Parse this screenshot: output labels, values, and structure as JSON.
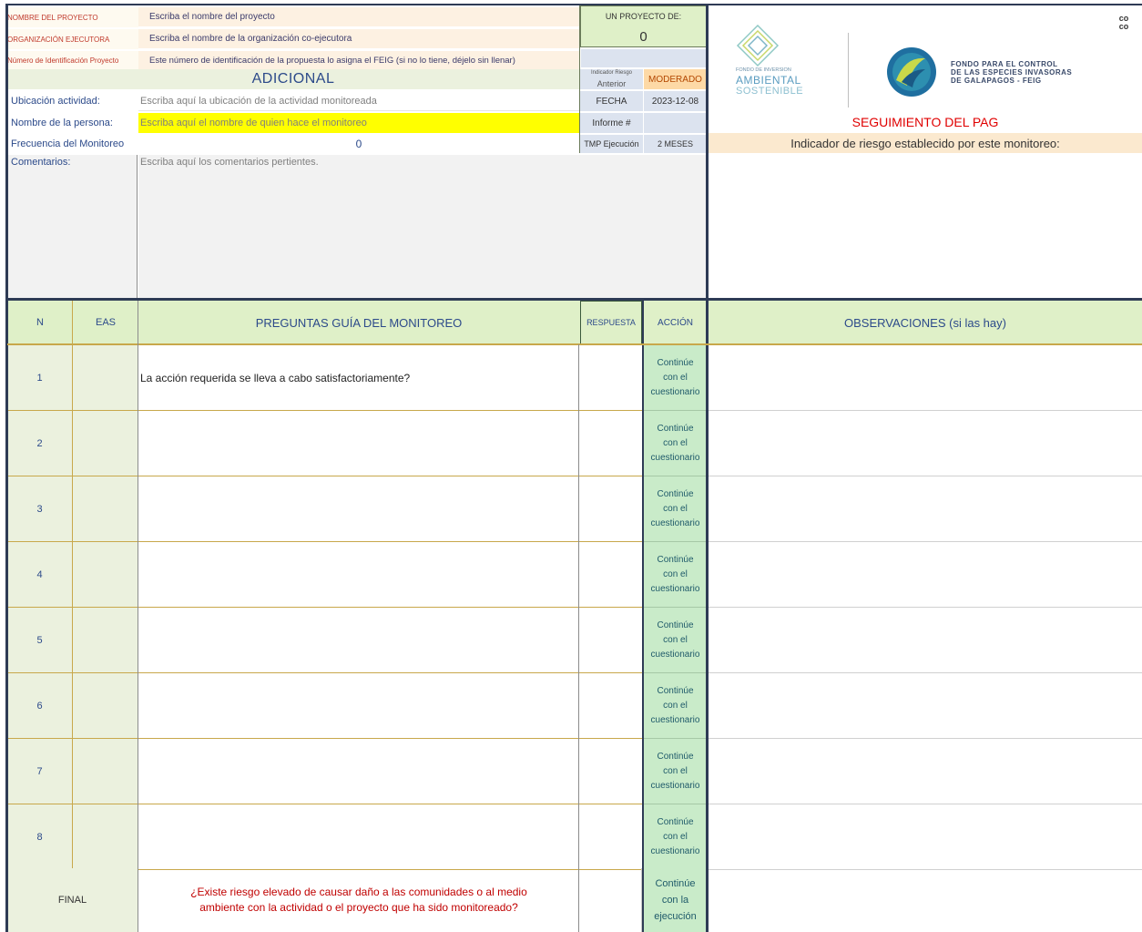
{
  "header": {
    "nombre_label": "NOMBRE DEL PROYECTO",
    "nombre_value": "Escriba el nombre del proyecto",
    "org_label": "ORGANIZACIÓN EJECUTORA",
    "org_value": "Escriba el nombre de la organización co-ejecutora",
    "id_label": "Número de Identificación Proyecto",
    "id_value": "Este número de identificación de la propuesta lo asigna el FEIG (si no lo tiene, déjelo sin llenar)",
    "un_proyecto_label": "UN PROYECTO DE:",
    "un_proyecto_value": "0",
    "corner_mark": "co co"
  },
  "adicional": {
    "title": "ADICIONAL",
    "riesgo_anterior_label_small": "Indicador Riesgo",
    "riesgo_anterior_label": "Anterior",
    "riesgo_anterior_value": "MODERADO",
    "ubicacion_label": "Ubicación actividad:",
    "ubicacion_value": "Escriba aquí la ubicación de la actividad monitoreada",
    "fecha_label": "FECHA",
    "fecha_value": "2023-12-08",
    "persona_label": "Nombre de la persona:",
    "persona_value": "Escriba aquí el nombre de quien hace el monitoreo",
    "informe_label": "Informe #",
    "informe_value": "",
    "frecuencia_label": "Frecuencia del Monitoreo",
    "frecuencia_value": "0",
    "tmp_label": "TMP Ejecución",
    "tmp_value": "2 MESES",
    "comentarios_label": "Comentarios:",
    "comentarios_value": "Escriba aquí los comentarios pertientes."
  },
  "logos": {
    "fias_line1": "FONDO DE INVERSIÓN",
    "fias_line2": "AMBIENTAL",
    "fias_line3": "SOSTENIBLE",
    "feig_line1": "FONDO PARA EL CONTROL",
    "feig_line2": "DE LAS ESPECIES INVASORAS",
    "feig_line3": "DE GALAPAGOS - FEIG"
  },
  "seguimiento": {
    "title": "SEGUIMIENTO DEL PAG",
    "indicador_label": "Indicador de riesgo establecido por este monitoreo:"
  },
  "table": {
    "headers": {
      "n": "N",
      "eas": "EAS",
      "preguntas": "PREGUNTAS GUÍA DEL MONITOREO",
      "respuesta": "RESPUESTA",
      "accion": "ACCIÓN",
      "observaciones": "OBSERVACIONES (si las hay)"
    },
    "rows": [
      {
        "n": "1",
        "question": "La acción requerida se lleva a cabo satisfactoriamente?",
        "accion1": "Continúe",
        "accion2": "con el",
        "accion3": "cuestionario"
      },
      {
        "n": "2",
        "question": "",
        "accion1": "Continúe",
        "accion2": "con el",
        "accion3": "cuestionario"
      },
      {
        "n": "3",
        "question": "",
        "accion1": "Continúe",
        "accion2": "con el",
        "accion3": "cuestionario"
      },
      {
        "n": "4",
        "question": "",
        "accion1": "Continúe",
        "accion2": "con el",
        "accion3": "cuestionario"
      },
      {
        "n": "5",
        "question": "",
        "accion1": "Continúe",
        "accion2": "con el",
        "accion3": "cuestionario"
      },
      {
        "n": "6",
        "question": "",
        "accion1": "Continúe",
        "accion2": "con el",
        "accion3": "cuestionario"
      },
      {
        "n": "7",
        "question": "",
        "accion1": "Continúe",
        "accion2": "con el",
        "accion3": "cuestionario"
      },
      {
        "n": "8",
        "question": "",
        "accion1": "Continúe",
        "accion2": "con el",
        "accion3": "cuestionario"
      }
    ],
    "final": {
      "label": "FINAL",
      "question_line1": "¿Existe riesgo elevado de causar daño a las comunidades o al medio",
      "question_line2": "ambiente con la actividad o el proyecto que ha sido monitoreado?",
      "accion1": "Continúe",
      "accion2": "con la",
      "accion3": "ejecución"
    }
  },
  "colors": {
    "label_red": "#c0392b",
    "header_green": "#dff0c8",
    "accion_green": "#c9ebc9",
    "lavender": "#dce3ef",
    "yellow": "#ffff00",
    "moderado_orange": "#fdd9a6",
    "frame_navy": "#2e3b55"
  }
}
